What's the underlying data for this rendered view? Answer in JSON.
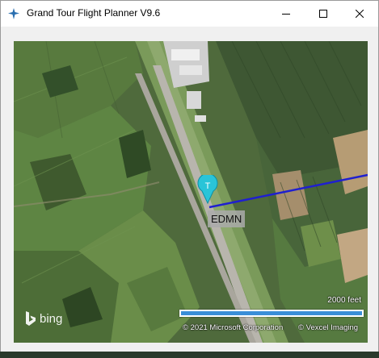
{
  "window": {
    "title": "Grand Tour Flight Planner V9.6"
  },
  "map": {
    "airport_code": "EDMN",
    "waypoint_marker_letter": "T",
    "scale_label": "2000 feet",
    "copyright_microsoft": "© 2021 Microsoft Corporation",
    "copyright_vexcel": "© Vexcel Imaging",
    "provider_logo": "bing",
    "route_color": "#1f1fd0",
    "marker_color": "#29c4d8"
  }
}
